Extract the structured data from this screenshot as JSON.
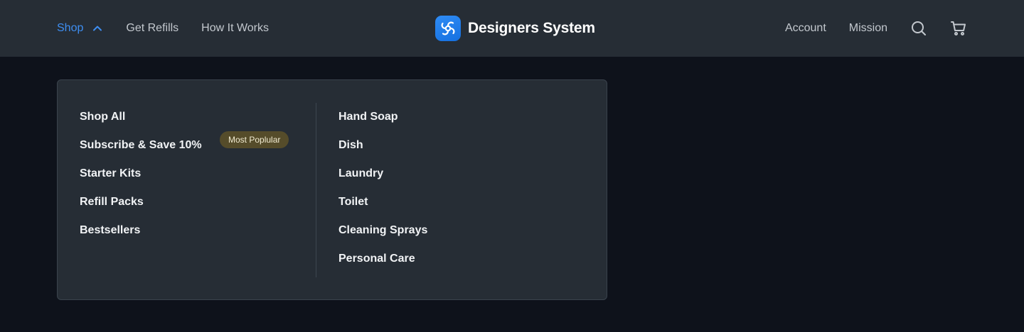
{
  "header": {
    "nav_left": [
      {
        "label": "Shop"
      },
      {
        "label": "Get Refills"
      },
      {
        "label": "How It Works"
      }
    ],
    "brand": {
      "name": "Designers System",
      "logo_icon": "pinwheel-icon",
      "logo_color": "#1f7ff0"
    },
    "nav_right": [
      {
        "label": "Account"
      },
      {
        "label": "Mission"
      }
    ],
    "icons": [
      "search-icon",
      "cart-icon"
    ],
    "active_color": "#3e8ef1"
  },
  "dropdown": {
    "left_column": [
      {
        "label": "Shop All"
      },
      {
        "label": "Subscribe & Save 10%",
        "badge": "Most Poplular"
      },
      {
        "label": "Starter Kits"
      },
      {
        "label": "Refill Packs"
      },
      {
        "label": "Bestsellers"
      }
    ],
    "right_column": [
      {
        "label": "Hand Soap"
      },
      {
        "label": "Dish"
      },
      {
        "label": "Laundry"
      },
      {
        "label": "Toilet"
      },
      {
        "label": "Cleaning Sprays"
      },
      {
        "label": "Personal Care"
      }
    ]
  }
}
